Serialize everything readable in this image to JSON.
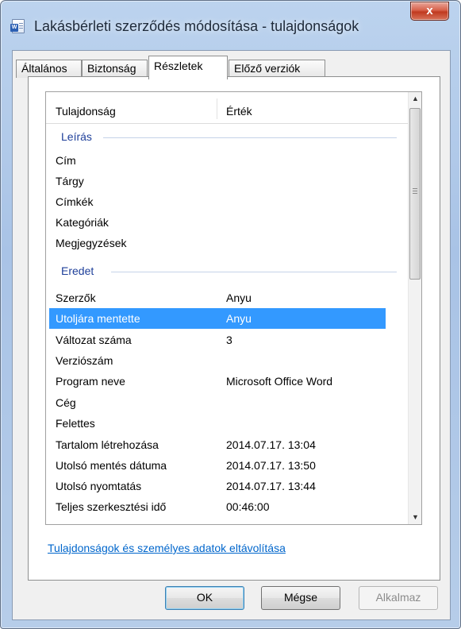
{
  "window": {
    "title": "Lakásbérleti szerződés módosítása - tulajdonságok",
    "close_glyph": "x",
    "app_icon": "word-document-icon"
  },
  "tabs": [
    {
      "label": "Általános",
      "active": false
    },
    {
      "label": "Biztonság",
      "active": false
    },
    {
      "label": "Részletek",
      "active": true
    },
    {
      "label": "Előző verziók",
      "active": false
    }
  ],
  "list": {
    "header": {
      "property": "Tulajdonság",
      "value": "Érték"
    },
    "groups": [
      {
        "label": "Leírás",
        "rows": [
          {
            "property": "Cím",
            "value": ""
          },
          {
            "property": "Tárgy",
            "value": ""
          },
          {
            "property": "Címkék",
            "value": ""
          },
          {
            "property": "Kategóriák",
            "value": ""
          },
          {
            "property": "Megjegyzések",
            "value": ""
          }
        ]
      },
      {
        "label": "Eredet",
        "rows": [
          {
            "property": "Szerzők",
            "value": "Anyu"
          },
          {
            "property": "Utoljára mentette",
            "value": "Anyu",
            "selected": true
          },
          {
            "property": "Változat száma",
            "value": "3"
          },
          {
            "property": "Verziószám",
            "value": ""
          },
          {
            "property": "Program neve",
            "value": "Microsoft Office Word"
          },
          {
            "property": "Cég",
            "value": ""
          },
          {
            "property": "Felettes",
            "value": ""
          },
          {
            "property": "Tartalom létrehozása",
            "value": "2014.07.17. 13:04"
          },
          {
            "property": "Utolsó mentés dátuma",
            "value": "2014.07.17. 13:50"
          },
          {
            "property": "Utolsó nyomtatás",
            "value": "2014.07.17. 13:44"
          },
          {
            "property": "Teljes szerkesztési idő",
            "value": "00:46:00"
          }
        ]
      }
    ],
    "scroll_up_glyph": "▲",
    "scroll_down_glyph": "▼"
  },
  "remove_link": "Tulajdonságok és személyes adatok eltávolítása",
  "buttons": {
    "ok": "OK",
    "cancel": "Mégse",
    "apply": "Alkalmaz"
  },
  "colors": {
    "selection": "#3399ff",
    "group_label": "#1e3f9a",
    "link": "#0066cc",
    "close_button": "#c0391f"
  }
}
